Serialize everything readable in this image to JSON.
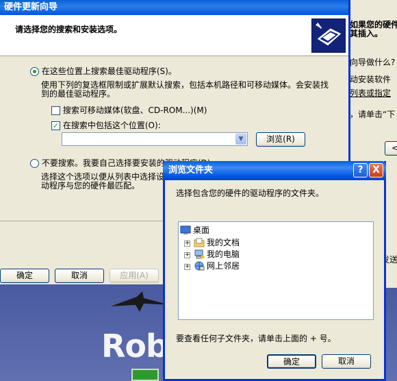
{
  "wizard": {
    "title": "硬件更新向导",
    "header": "请选择您的搜索和安装选项。",
    "option_search": "在这些位置上搜索最佳驱动程序(S)。",
    "option_search_desc1": "使用下列的复选框限制或扩展默认搜索，包括本机路径和可移动媒体。会安装找",
    "option_search_desc2": "到的最佳驱动程序。",
    "check_removable": "搜索可移动媒体(软盘、CD-ROM...)(M)",
    "check_include_location": "在搜索中包括这个位置(O):",
    "path_value": "",
    "browse_button": "浏览(R)",
    "option_manual": "不要搜索。我要自己选择要安装的驱动程序(D)。",
    "option_manual_desc1": "选择这个选项以便从列表中选择设",
    "option_manual_desc2": "动程序与您的硬件最匹配。"
  },
  "properties": {
    "ok": "确定",
    "cancel": "取消",
    "apply": "应用(A)"
  },
  "background_window": {
    "line1": "如果您的硬件",
    "line2": "其插入。",
    "line3": "向导做什么?",
    "line4": "动安装软件",
    "line5": "列表或指定",
    "line6": "，请单击“下",
    "button_partial": "<",
    "line7": "发送"
  },
  "browse_dialog": {
    "title": "浏览文件夹",
    "help": "?",
    "close": "X",
    "prompt": "选择包含您的硬件的驱动程序的文件夹。",
    "tree": [
      {
        "label": "桌面",
        "icon": "desktop-icon"
      },
      {
        "label": "我的文档",
        "icon": "my-documents-icon"
      },
      {
        "label": "我的电脑",
        "icon": "my-computer-icon"
      },
      {
        "label": "网上邻居",
        "icon": "network-places-icon"
      }
    ],
    "hint": "要查看任何子文件夹，请单击上面的 + 号。",
    "ok": "确定",
    "cancel": "取消"
  },
  "desktop": {
    "text": "Robe"
  }
}
